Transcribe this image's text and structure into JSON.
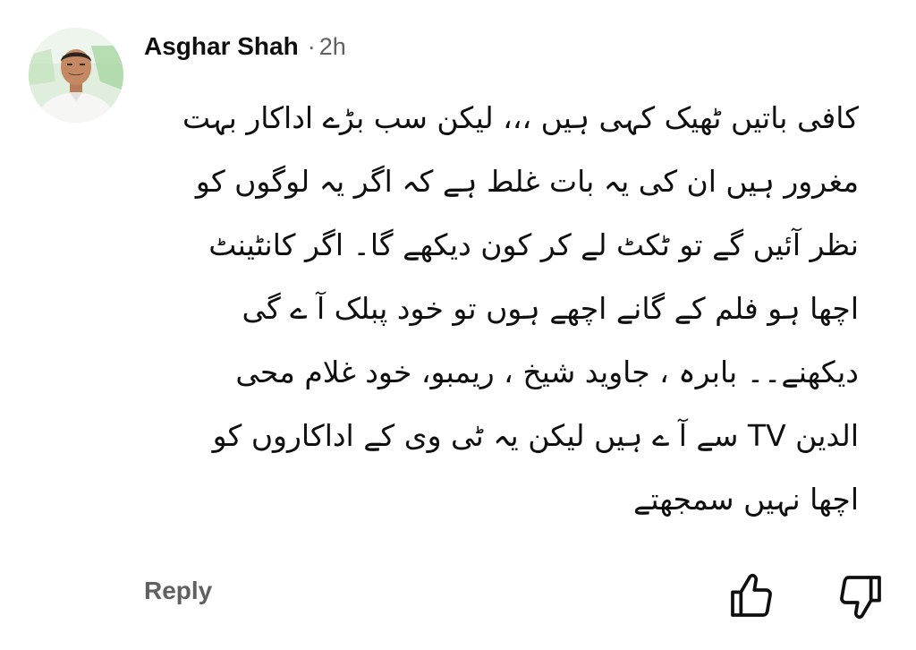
{
  "comment": {
    "author": "Asghar Shah",
    "separator": "·",
    "time_ago": "2h",
    "body_lines": [
      "کافی باتیں ٹھیک کہی ہیں ،،، لیکن سب بڑے اداکار بہت",
      "مغرور ہیں ان کی یہ بات غلط ہے کہ اگر یہ لوگوں کو",
      "نظر آئیں گے تو ٹکٹ لے کر کون دیکھے گا۔ اگر کانٹینٹ",
      "اچھا ہو فلم کے گانے اچھے ہوں تو خود پبلک آ ے گی",
      "دیکھنے۔۔ بابرہ ، جاوید شیخ ، ریمبو، خود غلام محی",
      "الدین TV سے آ ے ہیں لیکن یہ ٹی وی کے اداکاروں کو",
      "اچھا نہیں سمجھتے"
    ]
  },
  "actions": {
    "reply_label": "Reply",
    "like_icon": "thumb-up-outline",
    "dislike_icon": "thumb-down-outline"
  },
  "colors": {
    "text": "#0f0f0f",
    "secondary": "#606060",
    "background": "#ffffff"
  }
}
